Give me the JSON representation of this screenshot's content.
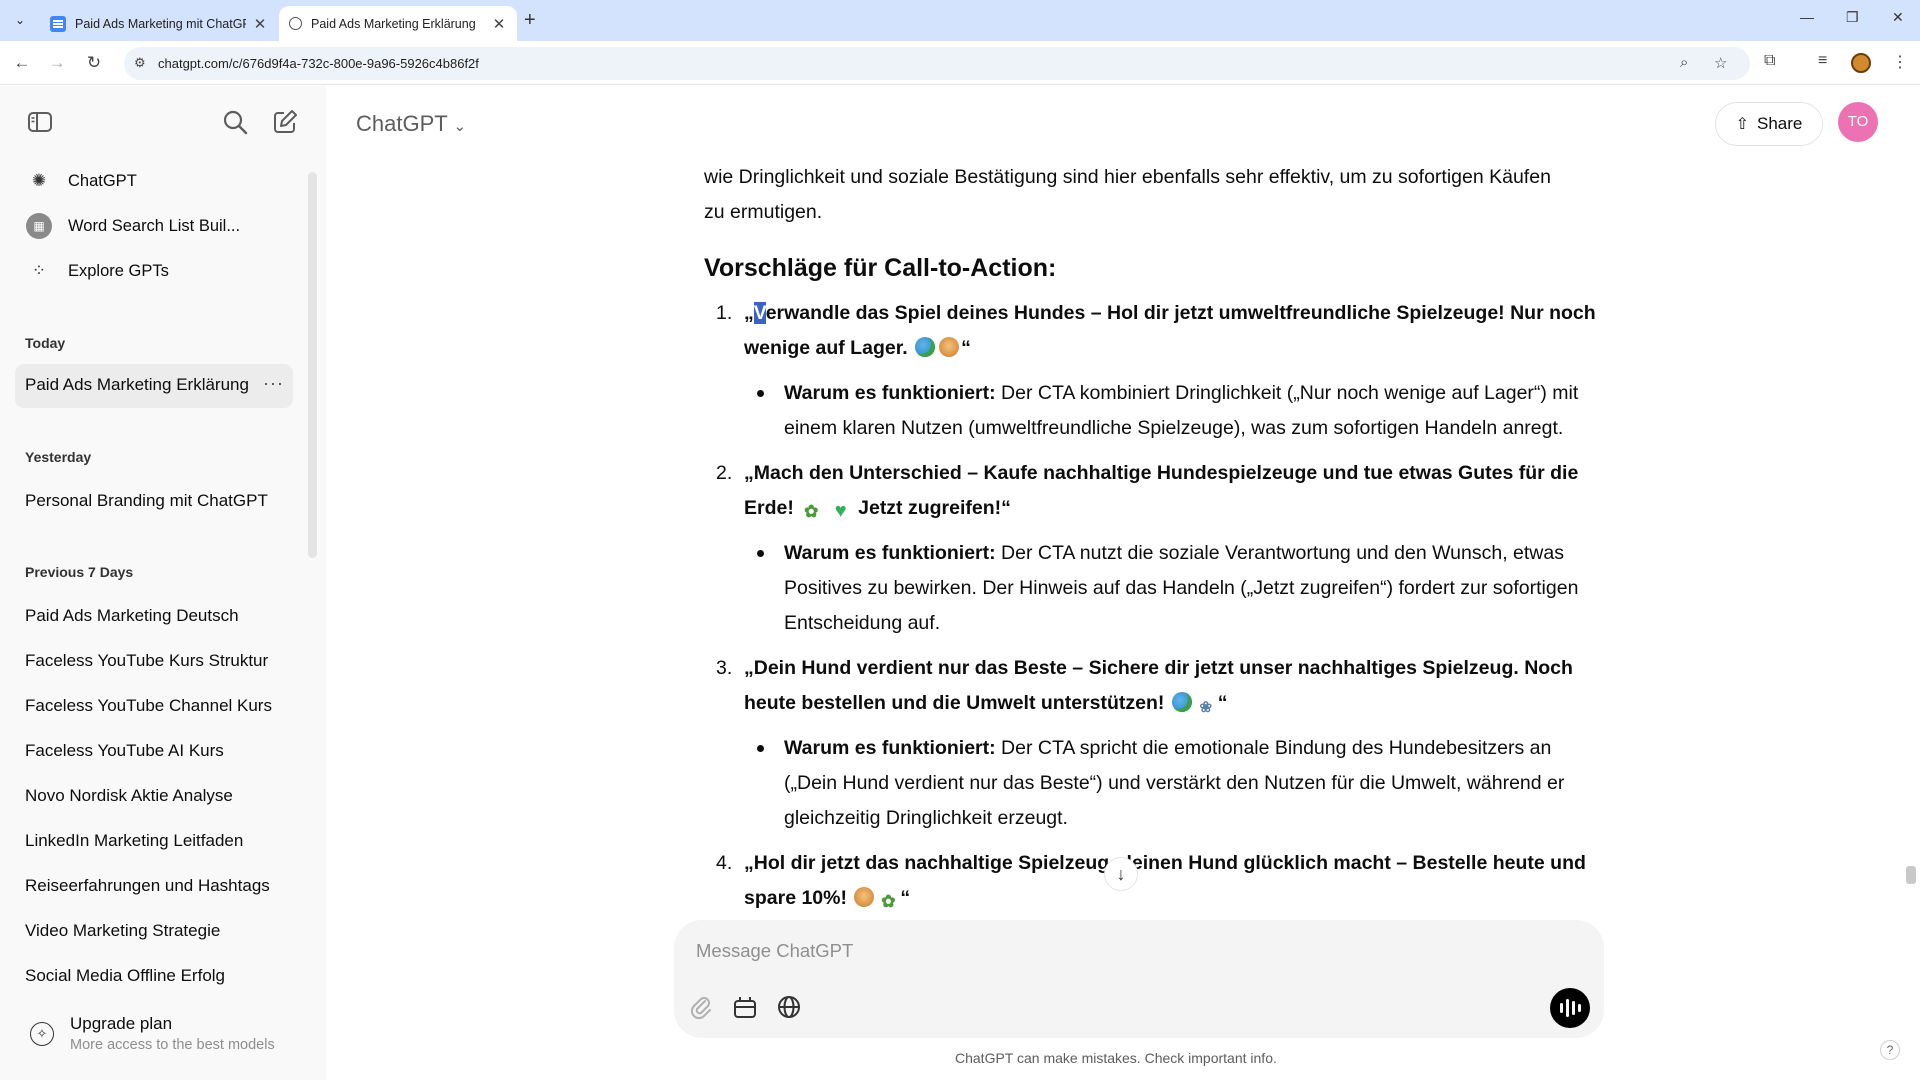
{
  "browser": {
    "tabs": [
      {
        "title": "Paid Ads Marketing mit ChatGPT"
      },
      {
        "title": "Paid Ads Marketing Erklärung"
      }
    ],
    "url": "chatgpt.com/c/676d9f4a-732c-800e-9a96-5926c4b86f2f"
  },
  "sidebar": {
    "top_items": [
      {
        "label": "ChatGPT",
        "icon": "openai-logo-icon"
      },
      {
        "label": "Word Search List Buil...",
        "icon": "gpt-avatar-icon"
      },
      {
        "label": "Explore GPTs",
        "icon": "grid-icon"
      }
    ],
    "sections": [
      {
        "heading": "Today",
        "items": [
          "Paid Ads Marketing Erklärung"
        ]
      },
      {
        "heading": "Yesterday",
        "items": [
          "Personal Branding mit ChatGPT"
        ]
      },
      {
        "heading": "Previous 7 Days",
        "items": [
          "Paid Ads Marketing Deutsch",
          "Faceless YouTube Kurs Struktur",
          "Faceless YouTube Channel Kurs",
          "Faceless YouTube AI Kurs",
          "Novo Nordisk Aktie Analyse",
          "LinkedIn Marketing Leitfaden",
          "Reiseerfahrungen und Hashtags",
          "Video Marketing Strategie",
          "Social Media Offline Erfolg"
        ]
      }
    ],
    "upgrade": {
      "title": "Upgrade plan",
      "subtitle": "More access to the best models"
    }
  },
  "header": {
    "model": "ChatGPT",
    "share_label": "Share",
    "avatar_initials": "TO"
  },
  "message": {
    "intro_line1": "wie Dringlichkeit und soziale Bestätigung sind hier ebenfalls sehr effektiv, um zu sofortigen Käufen",
    "intro_line2": "zu ermutigen.",
    "heading": "Vorschläge für Call-to-Action:",
    "why_label": "Warum es funktioniert:",
    "ctas": [
      {
        "num": "1.",
        "open_quote": "„",
        "cursor_char": "V",
        "quote": "erwandle das Spiel deines Hundes – Hol dir jetzt umweltfreundliche Spielzeuge! Nur noch wenige auf Lager.",
        "close": "“",
        "why": "Der CTA kombiniert Dringlichkeit („Nur noch wenige auf Lager“) mit einem klaren Nutzen (umweltfreundliche Spielzeuge), was zum sofortigen Handeln anregt."
      },
      {
        "num": "2.",
        "quote": "„Mach den Unterschied – Kaufe nachhaltige Hundespielzeuge und tue etwas Gutes für die Erde!",
        "quote_tail": "Jetzt zugreifen!“",
        "why": "Der CTA nutzt die soziale Verantwortung und den Wunsch, etwas Positives zu bewirken. Der Hinweis auf das Handeln („Jetzt zugreifen“) fordert zur sofortigen Entscheidung auf."
      },
      {
        "num": "3.",
        "quote": "„Dein Hund verdient nur das Beste – Sichere dir jetzt unser nachhaltiges Spielzeug. Noch heute bestellen und die Umwelt unterstützen!",
        "close": "“",
        "why": "Der CTA spricht die emotionale Bindung des Hundebesitzers an („Dein Hund verdient nur das Beste“) und verstärkt den Nutzen für die Umwelt, während er gleichzeitig Dringlichkeit erzeugt."
      },
      {
        "num": "4.",
        "quote": "„Hol dir jetzt das nachhaltige Spielzeug,    deinen Hund glücklich macht – Bestelle heute und spare 10%!",
        "close": "“"
      }
    ]
  },
  "composer": {
    "placeholder": "Message ChatGPT"
  },
  "footer": {
    "disclaimer": "ChatGPT can make mistakes. Check important info.",
    "help": "?"
  }
}
